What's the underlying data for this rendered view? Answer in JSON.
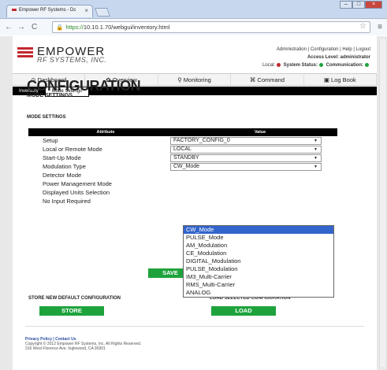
{
  "browser": {
    "tab_title": "Empower RF Systems - Dc",
    "url_scheme": "https://",
    "url_rest": "10.10.1.70/webgui/inventory.html"
  },
  "header": {
    "logo_line1": "EMPOWER",
    "logo_line2": "RF SYSTEMS, INC.",
    "links": "Administration | Configuration | Help | Logout",
    "access": "Access Level: administrator",
    "status_local": "Local:",
    "status_system": "System Status:",
    "status_comm": "Communication:",
    "colors": {
      "local": "#c3282e",
      "system": "#1ea33c",
      "comm": "#1ea33c"
    }
  },
  "nav": {
    "items": [
      "⊙ Dashboard",
      "✿ Overview",
      "⚲ Monitoring",
      "⌘ Command",
      "▣ Log Book"
    ]
  },
  "subnav": {
    "inventory": "Inventory",
    "mode_settings": "Mode Settings"
  },
  "page": {
    "title": "CONFIGURATION",
    "subtitle": "MODE SETTINGS",
    "section": "MODE SETTINGS"
  },
  "table": {
    "col_attribute": "Attribute",
    "col_value": "Value",
    "rows": [
      {
        "label": "Setup",
        "value": "FACTORY_CONFIG_0"
      },
      {
        "label": "Local or Remote Mode",
        "value": "LOCAL"
      },
      {
        "label": "Start-Up Mode",
        "value": "STANDBY"
      },
      {
        "label": "Modulation Type",
        "value": "CW_Mode"
      },
      {
        "label": "Detector Mode",
        "value": ""
      },
      {
        "label": "Power Management Mode",
        "value": ""
      },
      {
        "label": "Displayed Units Selection",
        "value": ""
      },
      {
        "label": "No Input Required",
        "value": ""
      }
    ]
  },
  "dropdown": {
    "options": [
      "CW_Mode",
      "PULSE_Mode",
      "AM_Modulation",
      "CE_Modulation",
      "DIGITAL_Modulation",
      "PULSE_Modulation",
      "IM3_Multi-Carrier",
      "RMS_Multi-Carrier",
      "ANALOG"
    ],
    "highlighted": "CW_Mode"
  },
  "buttons": {
    "save": "SAVE",
    "store_label": "STORE NEW DEFAULT CONFIGURATION",
    "store": "STORE",
    "load_label": "LOAD SELECTED CONFIGURATION",
    "load": "LOAD"
  },
  "footer": {
    "links": "Privacy Policy | Contact Us",
    "copyright": "Copyright © 2012 Empower RF Systems, Inc. All Rights Reserved.",
    "address": "316 West Florence Ave. Inglewood, CA 90301"
  }
}
